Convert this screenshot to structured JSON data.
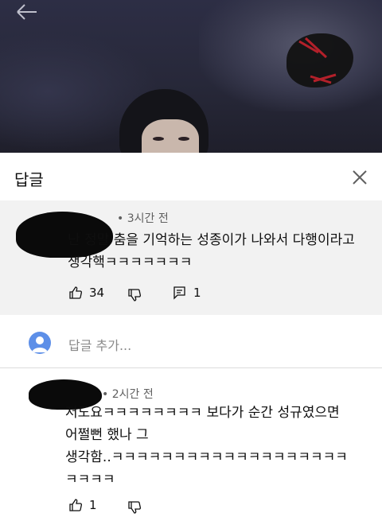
{
  "sheet": {
    "title": "답글",
    "close_icon": "close-icon"
  },
  "comment": {
    "time": "3시간 전",
    "text_line1": "난 정말 춤을 기억하는 성종이가 나와서 다행이라고",
    "text_line2": "생각핵ㅋㅋㅋㅋㅋㅋㅋ",
    "likes": "34",
    "replies": "1"
  },
  "reply_box": {
    "placeholder": "답글 추가..."
  },
  "reply": {
    "time": "2시간 전",
    "text_line1": "저도요ㅋㅋㅋㅋㅋㅋㅋㅋ 보다가 순간 성규였으면",
    "text_line2": "어쩔뻔 했나 그",
    "text_line3": "생각함..ㅋㅋㅋㅋㅋㅋㅋㅋㅋㅋㅋㅋㅋㅋㅋㅋㅋㅋㅋ",
    "text_line4": "ㅋㅋㅋㅋ",
    "likes": "1"
  },
  "icons": {
    "back": "arrow-left-icon",
    "like": "thumbs-up-icon",
    "dislike": "thumbs-down-icon",
    "reply": "comment-icon",
    "avatar": "account-avatar"
  },
  "colors": {
    "comment_highlight": "#f2f2f2",
    "avatar": "#5d8fe8",
    "meta_text": "#606060"
  }
}
